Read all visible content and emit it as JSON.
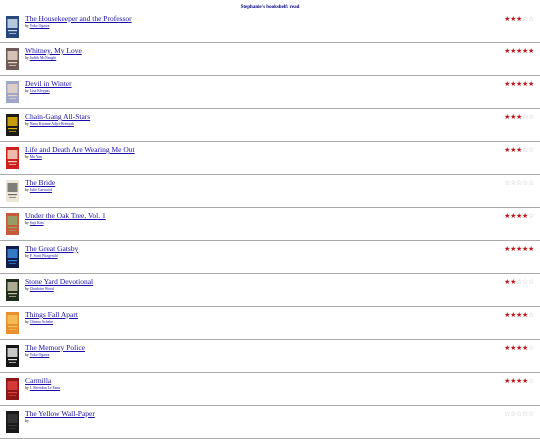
{
  "shelf": {
    "title": "Stephanie's bookshelf: read"
  },
  "books": [
    {
      "title": "The Housekeeper and the Professor",
      "by": "by",
      "author": "Yoko Ogawa",
      "rating": 3,
      "cover_colors": [
        "#27487a",
        "#cfe0f0"
      ]
    },
    {
      "title": "Whitney, My Love",
      "by": "by",
      "author": "Judith McNaught",
      "rating": 5,
      "cover_colors": [
        "#6f5a57",
        "#e8d5c7"
      ]
    },
    {
      "title": "Devil in Winter",
      "by": "by",
      "author": "Lisa Kleypas",
      "rating": 5,
      "cover_colors": [
        "#9fa6c7",
        "#e7d3c8"
      ]
    },
    {
      "title": "Chain-Gang All-Stars",
      "by": "by",
      "author": "Nana Kwame Adjei-Brenyah",
      "rating": 3,
      "cover_colors": [
        "#1b1b1b",
        "#e5b200"
      ]
    },
    {
      "title": "Life and Death Are Wearing Me Out",
      "by": "by",
      "author": "Mo Yan",
      "rating": 3,
      "cover_colors": [
        "#cf1f1f",
        "#f2d7c4"
      ]
    },
    {
      "title": "The Bride",
      "by": "by",
      "author": "Julie Garwood",
      "rating": 0,
      "cover_colors": [
        "#ece6d8",
        "#6b6b6b"
      ]
    },
    {
      "title": "Under the Oak Tree, Vol. 1",
      "by": "by",
      "author": "Suji Kim",
      "rating": 4,
      "cover_colors": [
        "#c65a3c",
        "#8da86a"
      ]
    },
    {
      "title": "The Great Gatsby",
      "by": "by",
      "author": "F. Scott Fitzgerald",
      "rating": 5,
      "cover_colors": [
        "#0f1e4a",
        "#3b8ad9"
      ]
    },
    {
      "title": "Stone Yard Devotional",
      "by": "by",
      "author": "Charlotte Wood",
      "rating": 2,
      "cover_colors": [
        "#1f2d1a",
        "#c8c0a8"
      ]
    },
    {
      "title": "Things Fall Apart",
      "by": "by",
      "author": "Chinua Achebe",
      "rating": 4,
      "cover_colors": [
        "#e9902e",
        "#f4c35a"
      ]
    },
    {
      "title": "The Memory Police",
      "by": "by",
      "author": "Yoko Ogawa",
      "rating": 4,
      "cover_colors": [
        "#151515",
        "#e5e5e5"
      ]
    },
    {
      "title": "Carmilla",
      "by": "by",
      "author": "J. Sheridan Le Fanu",
      "rating": 4,
      "cover_colors": [
        "#8c1616",
        "#e14040"
      ]
    },
    {
      "title": "The Yellow Wall-Paper",
      "by": "by",
      "author": "",
      "rating": 0,
      "cover_colors": [
        "#1a1a1a",
        "#3a3a3a"
      ]
    }
  ],
  "colors": {
    "link": "#1a0dab",
    "star_on": "#c0151b",
    "star_off": "#b9b9b9",
    "divider": "#aaaaaa"
  },
  "icons": {
    "star": "star-icon"
  }
}
